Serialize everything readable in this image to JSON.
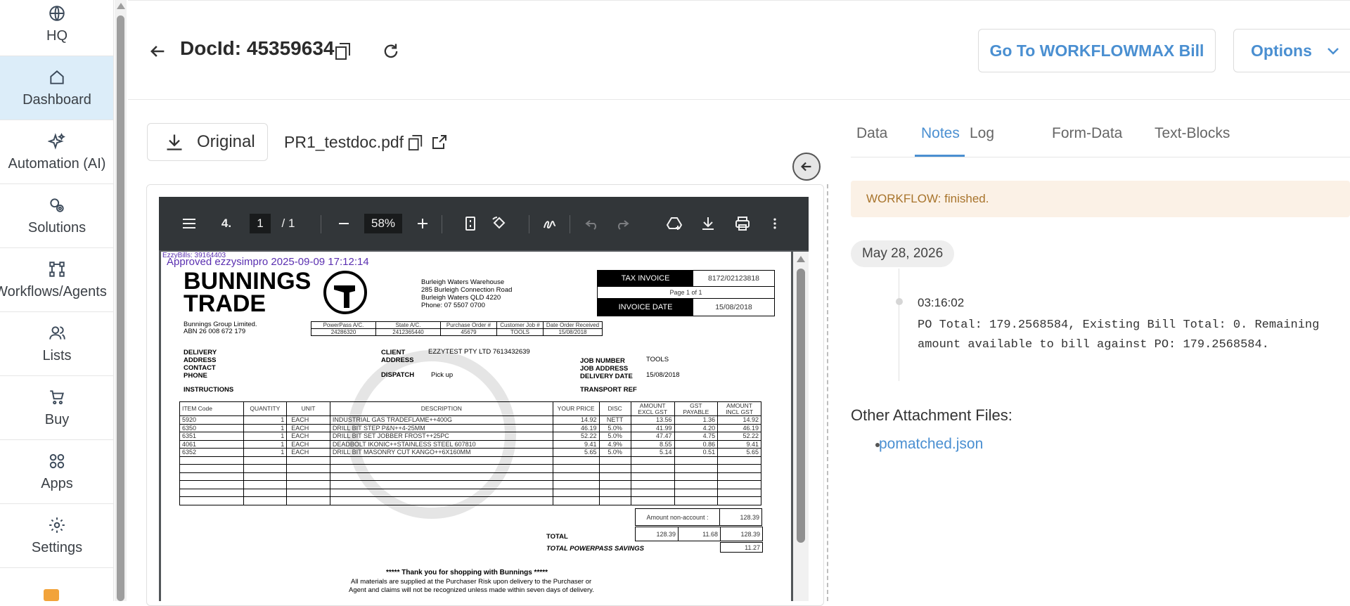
{
  "sidebar": {
    "items": [
      {
        "label": "HQ",
        "icon": "globe-icon"
      },
      {
        "label": "Dashboard",
        "icon": "home-icon",
        "active": true
      },
      {
        "label": "Automation (AI)",
        "icon": "sparkles-icon"
      },
      {
        "label": "Solutions",
        "icon": "gears-icon"
      },
      {
        "label": "Workflows/Agents",
        "icon": "workflow-icon"
      },
      {
        "label": "Lists",
        "icon": "users-icon"
      },
      {
        "label": "Buy",
        "icon": "cart-icon"
      },
      {
        "label": "Apps",
        "icon": "apps-icon"
      },
      {
        "label": "Settings",
        "icon": "gear-icon"
      }
    ]
  },
  "header": {
    "title": "DocId: 45359634",
    "workflow_button": "Go To WORKFLOWMAX Bill",
    "options_button": "Options"
  },
  "viewer": {
    "original_button": "Original",
    "filename": "PR1_testdoc.pdf",
    "toolbar": {
      "page_current": "1",
      "page_total": "/ 1",
      "zoom": "58%",
      "page_badge": "4."
    }
  },
  "pdf": {
    "stamp_small": "EzzyBills: 39164403",
    "stamp": "Approved ezzysimpro 2025-09-09 17:12:14",
    "logo_line1": "BUNNINGS",
    "logo_line2": "TRADE",
    "company": "Bunnings Group Limited.",
    "abn": "ABN 26 008 672 179",
    "warehouse": [
      "Burleigh Waters Warehouse",
      "285 Burleigh Connection Road",
      "Burleigh Waters  QLD  4220",
      "Phone: 07 5507 0700"
    ],
    "tax_invoice_label": "TAX INVOICE",
    "tax_invoice_no": "8172/02123818",
    "page_of": "Page 1 of 1",
    "invoice_date_label": "INVOICE DATE",
    "invoice_date": "15/08/2018",
    "ref_headers": [
      "PowerPass A/C.",
      "State A/C.",
      "Purchase Order #",
      "Customer Job #",
      "Date Order Received"
    ],
    "ref_values": [
      "24286320",
      "2412365440",
      "45679",
      "TOOLS",
      "15/08/2018"
    ],
    "delivery_labels": [
      "DELIVERY",
      "ADDRESS",
      "CONTACT",
      "PHONE"
    ],
    "client_label": "CLIENT",
    "client_value": "EZZYTEST PTY LTD  7613432639",
    "address_label": "ADDRESS",
    "dispatch_label": "DISPATCH",
    "dispatch_value": "Pick up",
    "job_labels": [
      "JOB NUMBER",
      "JOB ADDRESS",
      "DELIVERY DATE"
    ],
    "job_number": "TOOLS",
    "delivery_date": "15/08/2018",
    "instructions_label": "INSTRUCTIONS",
    "transport_label": "TRANSPORT REF",
    "item_headers": [
      "ITEM Code",
      "QUANTITY",
      "UNIT",
      "DESCRIPTION",
      "YOUR PRICE",
      "DISC",
      "AMOUNT EXCL GST",
      "GST PAYABLE",
      "AMOUNT INCL GST"
    ],
    "items": [
      [
        "5920",
        "1",
        "EACH",
        "INDUSTRIAL GAS TRADEFLAME++400G",
        "14.92",
        "NETT",
        "13.56",
        "1.36",
        "14.92"
      ],
      [
        "6350",
        "1",
        "EACH",
        "DRILL BIT STEP P&N++4-25MM",
        "46.19",
        "5.0%",
        "41.99",
        "4.20",
        "46.19"
      ],
      [
        "6351",
        "1",
        "EACH",
        "DRILL BIT SET JOBBER FROST++25PC",
        "52.22",
        "5.0%",
        "47.47",
        "4.75",
        "52.22"
      ],
      [
        "4061",
        "1",
        "EACH",
        "DEADBOLT IKONIC++STAINLESS STEEL 607810",
        "9.41",
        "4.9%",
        "8.55",
        "0.86",
        "9.41"
      ],
      [
        "6352",
        "1",
        "EACH",
        "DRILL BIT MASONRY CUT KANGO++6X160MM",
        "5.65",
        "5.0%",
        "5.14",
        "0.51",
        "5.65"
      ]
    ],
    "non_account_label": "Amount non-account :",
    "non_account_value": "128.39",
    "total_label": "TOTAL",
    "total_excl": "128.39",
    "total_gst": "11.68",
    "total_incl": "128.39",
    "savings_label": "TOTAL POWERPASS SAVINGS",
    "savings_value": "11.27",
    "thanks": "***** Thank you for shopping with Bunnings *****",
    "footer1": "All materials are supplied at the Purchaser Risk upon delivery to the Purchaser or",
    "footer2": "Agent and claims will not be recognized unless made within seven days of delivery."
  },
  "panel": {
    "tabs": [
      "Data",
      "Notes",
      "Log",
      "Form-Data",
      "Text-Blocks"
    ],
    "active_tab": "Notes",
    "alert": "WORKFLOW: finished.",
    "date": "May 28, 2026",
    "time": "03:16:02",
    "note_line1": "PO Total: 179.2568584, Existing Bill Total: 0. Remaining",
    "note_line2": "amount available to bill against PO: 179.2568584.",
    "attachments_title": "Other Attachment Files:",
    "attachment": "pomatched.json"
  }
}
